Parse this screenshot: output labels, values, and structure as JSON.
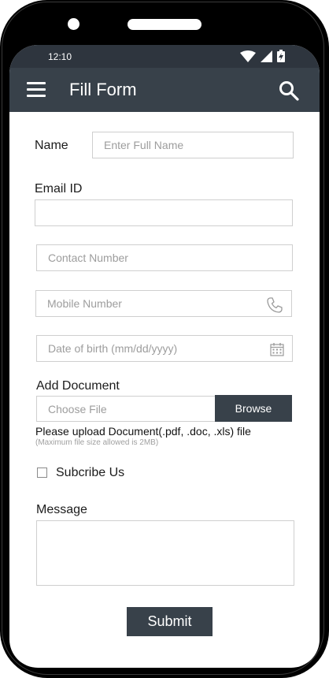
{
  "status_bar": {
    "time": "12:10",
    "icons": [
      "wifi-icon",
      "signal-icon",
      "battery-charging-icon"
    ]
  },
  "app_bar": {
    "title": "Fill Form",
    "left_icon": "hamburger-menu-icon",
    "right_icon": "search-icon"
  },
  "form": {
    "name_label": "Name",
    "name_placeholder": "Enter Full Name",
    "email_label": "Email ID",
    "email_value": "",
    "contact_placeholder": "Contact Number",
    "mobile_placeholder": "Mobile Number",
    "mobile_icon": "phone-icon",
    "dob_placeholder": "Date of birth (mm/dd/yyyy)",
    "dob_icon": "calendar-icon",
    "document_label": "Add Document",
    "file_placeholder": "Choose File",
    "browse_label": "Browse",
    "upload_note": "Please upload Document(.pdf, .doc, .xls) file",
    "upload_sub_note": "(Maximum file size allowed is 2MB)",
    "subscribe_label": "Subcribe Us",
    "subscribe_checked": false,
    "message_label": "Message",
    "message_value": "",
    "submit_label": "Submit"
  },
  "colors": {
    "app_bar": "#38414a",
    "status_bar": "#2e353e",
    "button": "#38414a",
    "field_border": "#cfcfcf"
  }
}
